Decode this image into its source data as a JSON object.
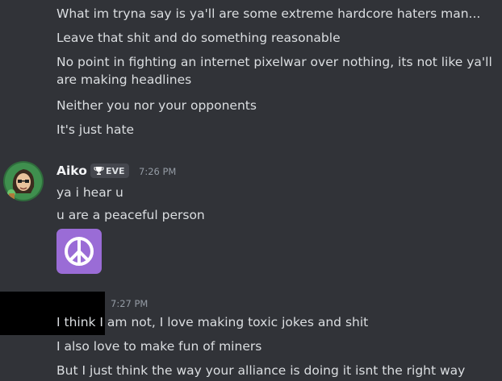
{
  "messages_prev": [
    "What im tryna say is ya'll are some extreme hardcore haters man...",
    "Leave that shit and do something reasonable",
    "No point in fighting an internet pixelwar over nothing, its not like ya'll are making headlines",
    "Neither you nor your opponents",
    "It's just hate"
  ],
  "aiko": {
    "username": "Aiko",
    "tag": "EVE",
    "timestamp": "7:26 PM",
    "messages": [
      "ya i hear u",
      "u are a peaceful person"
    ],
    "emoji": "peace-symbol"
  },
  "next": {
    "timestamp": "7:27 PM",
    "messages": [
      "I think I am not, I love making toxic jokes and shit",
      "I also love to make fun of miners",
      "But I just think the way your alliance is doing it isnt the right way"
    ]
  },
  "colors": {
    "background": "#313338",
    "text": "#dbdee1",
    "username": "#f2f3f5",
    "muted": "#949ba4",
    "emoji_bg": "#9a6cd6",
    "tag_bg": "#45474e"
  }
}
